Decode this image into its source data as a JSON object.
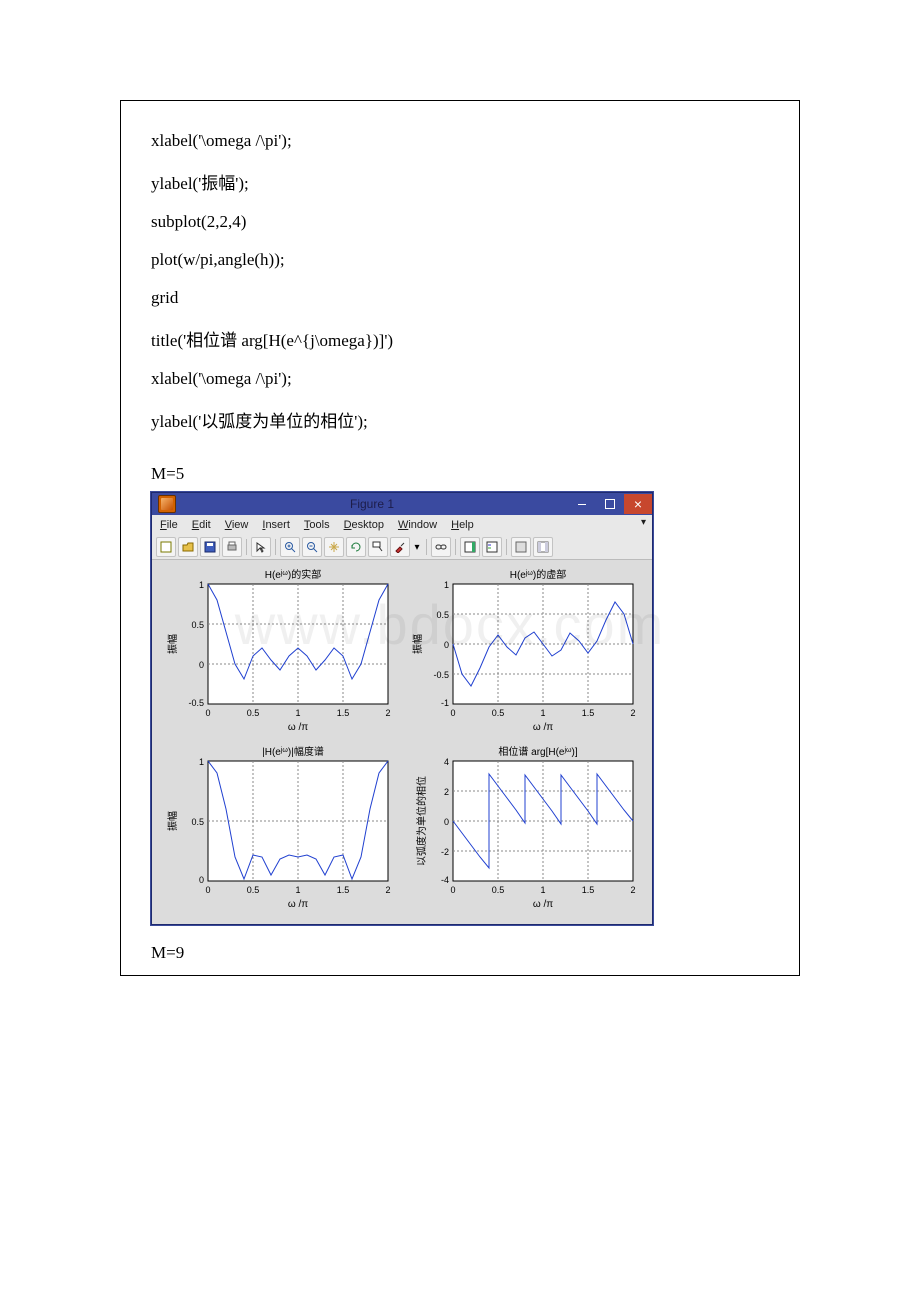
{
  "code": {
    "l1": "xlabel('\\omega /\\pi');",
    "l2": "ylabel('振幅');",
    "l3": "subplot(2,2,4)",
    "l4": "plot(w/pi,angle(h));",
    "l5": "grid",
    "l6": "title('相位谱 arg[H(e^{j\\omega})]')",
    "l7": "xlabel('\\omega /\\pi');",
    "l8": "ylabel('以弧度为单位的相位');"
  },
  "section_m5": "M=5",
  "section_m9": "M=9",
  "figwin": {
    "title": "Figure 1",
    "menu": {
      "file": "File",
      "edit": "Edit",
      "view": "View",
      "insert": "Insert",
      "tools": "Tools",
      "desktop": "Desktop",
      "window": "Window",
      "help": "Help"
    }
  },
  "subplots": {
    "tl": {
      "title": "H(e^{jω})的实部",
      "ylabel": "振幅",
      "xlabel": "ω /π"
    },
    "tr": {
      "title": "H(e^{jω})的虚部",
      "ylabel": "振幅",
      "xlabel": "ω /π"
    },
    "bl": {
      "title": "|H(e^{jω})|幅度谱",
      "ylabel": "振幅",
      "xlabel": "ω /π"
    },
    "br": {
      "title": "相位谱 arg[H(e^{jω})]",
      "ylabel": "以弧度为单位的相位",
      "xlabel": "ω /π"
    }
  },
  "ticks": {
    "x": [
      "0",
      "0.5",
      "1",
      "1.5",
      "2"
    ],
    "tl_y": [
      "-0.5",
      "0",
      "0.5",
      "1"
    ],
    "tr_y": [
      "-1",
      "-0.5",
      "0",
      "0.5",
      "1"
    ],
    "bl_y": [
      "0",
      "0.5",
      "1"
    ],
    "br_y": [
      "-4",
      "-2",
      "0",
      "2",
      "4"
    ]
  },
  "chart_data": [
    {
      "type": "line",
      "title": "H(e^{jω})的实部",
      "xlabel": "ω /π",
      "ylabel": "振幅",
      "xlim": [
        0,
        2
      ],
      "ylim": [
        -0.5,
        1
      ],
      "x": [
        0,
        0.1,
        0.2,
        0.3,
        0.4,
        0.5,
        0.6,
        0.7,
        0.8,
        0.9,
        1.0,
        1.1,
        1.2,
        1.3,
        1.4,
        1.5,
        1.6,
        1.7,
        1.8,
        1.9,
        2.0
      ],
      "values": [
        1.0,
        0.8,
        0.4,
        0.0,
        -0.18,
        0.1,
        0.2,
        0.05,
        -0.08,
        0.1,
        0.2,
        0.1,
        -0.08,
        0.05,
        0.2,
        0.1,
        -0.18,
        0.0,
        0.4,
        0.8,
        1.0
      ]
    },
    {
      "type": "line",
      "title": "H(e^{jω})的虚部",
      "xlabel": "ω /π",
      "ylabel": "振幅",
      "xlim": [
        0,
        2
      ],
      "ylim": [
        -1,
        1
      ],
      "x": [
        0,
        0.1,
        0.2,
        0.3,
        0.4,
        0.5,
        0.6,
        0.7,
        0.8,
        0.9,
        1.0,
        1.1,
        1.2,
        1.3,
        1.4,
        1.5,
        1.6,
        1.7,
        1.8,
        1.9,
        2.0
      ],
      "values": [
        0.0,
        -0.5,
        -0.7,
        -0.4,
        -0.05,
        0.15,
        -0.05,
        -0.18,
        0.1,
        0.2,
        0.0,
        -0.2,
        -0.1,
        0.18,
        0.05,
        -0.15,
        0.05,
        0.4,
        0.7,
        0.5,
        0.0
      ]
    },
    {
      "type": "line",
      "title": "|H(e^{jω})|幅度谱",
      "xlabel": "ω /π",
      "ylabel": "振幅",
      "xlim": [
        0,
        2
      ],
      "ylim": [
        0,
        1
      ],
      "x": [
        0,
        0.1,
        0.2,
        0.3,
        0.4,
        0.5,
        0.6,
        0.7,
        0.8,
        0.9,
        1.0,
        1.1,
        1.2,
        1.3,
        1.4,
        1.5,
        1.6,
        1.7,
        1.8,
        1.9,
        2.0
      ],
      "values": [
        1.0,
        0.9,
        0.6,
        0.2,
        0.02,
        0.22,
        0.2,
        0.05,
        0.18,
        0.22,
        0.2,
        0.22,
        0.18,
        0.05,
        0.2,
        0.22,
        0.02,
        0.2,
        0.6,
        0.9,
        1.0
      ]
    },
    {
      "type": "line",
      "title": "相位谱 arg[H(e^{jω})]",
      "xlabel": "ω /π",
      "ylabel": "以弧度为单位的相位",
      "xlim": [
        0,
        2
      ],
      "ylim": [
        -4,
        4
      ],
      "x": [
        0,
        0.1,
        0.2,
        0.3,
        0.4,
        0.4,
        0.5,
        0.6,
        0.7,
        0.8,
        0.8,
        0.9,
        1.0,
        1.1,
        1.2,
        1.2,
        1.3,
        1.4,
        1.5,
        1.6,
        1.6,
        1.7,
        1.8,
        1.9,
        2.0
      ],
      "values": [
        0.0,
        -0.8,
        -1.6,
        -2.4,
        -3.1,
        3.1,
        2.3,
        1.5,
        0.7,
        -0.1,
        3.0,
        2.2,
        1.4,
        0.6,
        -0.2,
        3.0,
        2.2,
        1.4,
        0.6,
        -0.2,
        3.1,
        2.3,
        1.5,
        0.7,
        0.0
      ]
    }
  ],
  "watermark": "www.bdocx.com"
}
